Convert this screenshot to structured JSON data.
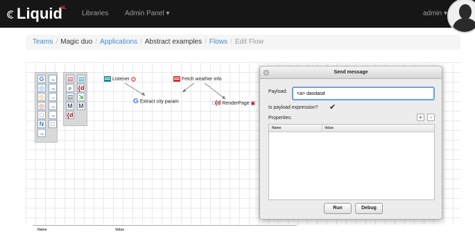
{
  "navbar": {
    "brand": "Liquid",
    "brand_sup": "ML",
    "links": [
      "Libraries",
      "Admin Panel ▾"
    ],
    "user": "admin ▾"
  },
  "breadcrumb": {
    "teams": "Teams",
    "team": "Magic duo",
    "applications": "Applications",
    "app": "Abstract examples",
    "flows": "Flows",
    "current": "Edit Flow"
  },
  "palette": {
    "left": [
      {
        "icon": "G",
        "color": "#3a7bd5"
      },
      {
        "icon": "→",
        "color": "#222"
      },
      {
        "icon": "◎",
        "color": "#4a90e2"
      },
      {
        "icon": "→",
        "color": "#222"
      },
      {
        "icon": "◎",
        "color": "#f0a030"
      },
      {
        "icon": "→",
        "color": "#2a9d2a"
      },
      {
        "icon": "◎",
        "color": "#e04040"
      },
      {
        "icon": "→",
        "color": "#c00"
      },
      {
        "icon": "□",
        "color": "#777"
      },
      {
        "icon": "→",
        "color": "#222"
      },
      {
        "icon": "N",
        "color": "#3a7bd5"
      },
      {
        "icon": "□",
        "color": "#777"
      },
      {
        "icon": "→",
        "color": "#222"
      }
    ],
    "right": [
      {
        "icon": "▤",
        "color": "#d03030"
      },
      {
        "icon": "▤",
        "color": "#1a8a9a"
      },
      {
        "icon": "⌕",
        "color": "#555"
      },
      {
        "icon": "{d",
        "color": "#a00"
      },
      {
        "icon": "▤",
        "color": "#555"
      },
      {
        "icon": "⇲",
        "color": "#2a9d2a"
      },
      {
        "icon": "M",
        "color": "#555"
      },
      {
        "icon": "M",
        "color": "#555"
      },
      {
        "icon": "{d",
        "color": "#a00"
      }
    ]
  },
  "nodes": {
    "listener": "Listener",
    "fetch": "Fetch weather info",
    "extract": "Extract city param",
    "render": "RenderPage"
  },
  "dialog": {
    "title": "Send message",
    "payload_label": "Payload:",
    "payload_value": "<a> dasdasd",
    "expression_label": "Is payload expression?",
    "expression_checked": "✔",
    "properties_label": "Properties:",
    "add": "+",
    "remove": "-",
    "col_name": "Name",
    "col_value": "Value",
    "run": "Run",
    "debug": "Debug"
  },
  "bottom_table": {
    "col_name": "Name",
    "col_value": "Value"
  }
}
